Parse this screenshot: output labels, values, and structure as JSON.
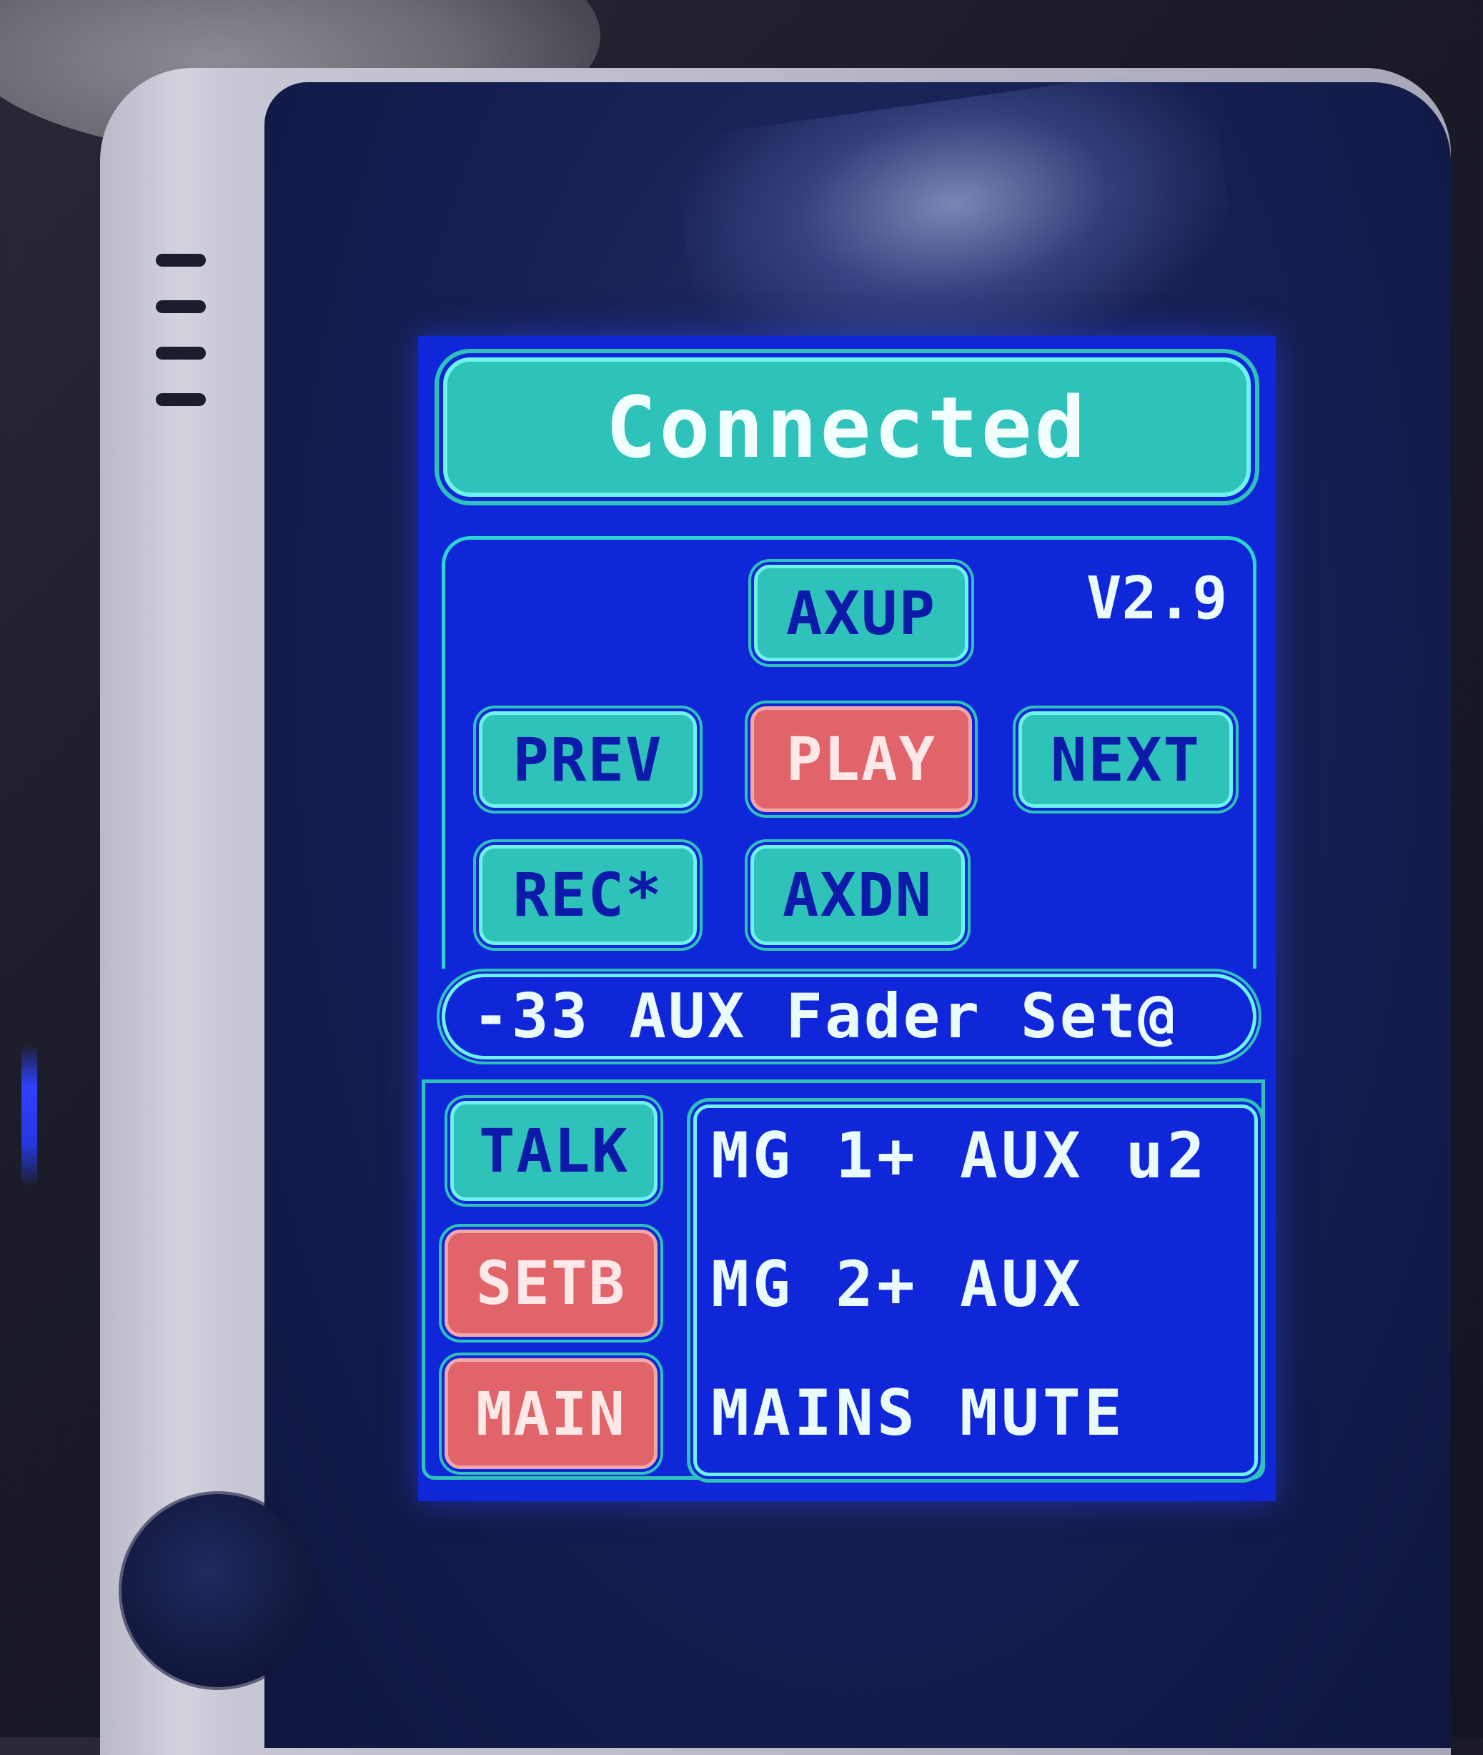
{
  "status": {
    "label": "Connected"
  },
  "version": "V2.9",
  "transport": {
    "axup": "AXUP",
    "prev": "PREV",
    "play": "PLAY",
    "next": "NEXT",
    "rec": "REC*",
    "axdn": "AXDN"
  },
  "fader_message": "-33 AUX Fader Set@",
  "side_buttons": {
    "talk": "TALK",
    "setb": "SETB",
    "main": "MAIN"
  },
  "info_lines": [
    "MG 1+ AUX u2",
    "MG 2+ AUX",
    "MAINS MUTE"
  ],
  "colors": {
    "screen_bg": "#0f27d8",
    "accent_teal": "#2fc2bb",
    "active_red": "#e0646a",
    "text_white": "#eafcff"
  }
}
